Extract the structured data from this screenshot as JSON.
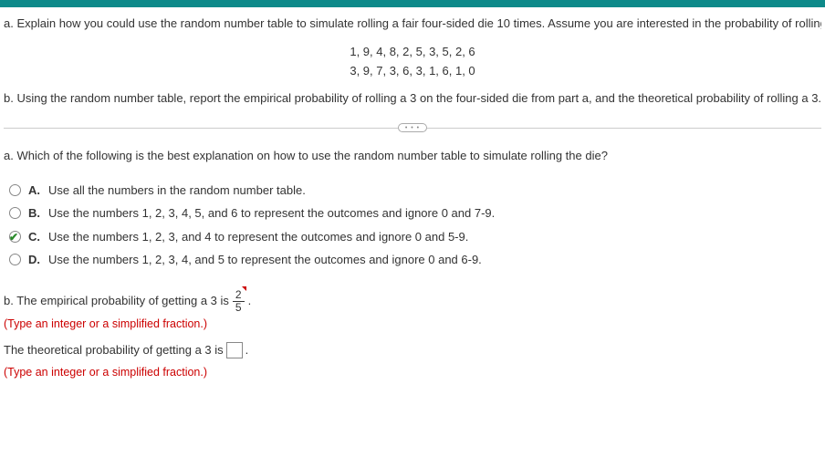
{
  "question_a": "a. Explain how you could use the random number table to simulate rolling a fair four-sided die 10 times. Assume you are interested in the probability of rolling",
  "numbers_line1": "1, 9, 4, 8, 2, 5, 3, 5, 2, 6",
  "numbers_line2": "3, 9, 7, 3, 6, 3, 1, 6, 1, 0",
  "question_b": "b. Using the random number table, report the empirical probability of rolling a 3 on the four-sided die from part a, and the theoretical probability of rolling a 3.",
  "expand_label": "• • •",
  "sub_a": "a. Which of the following is the best explanation on how to use the random number table to simulate rolling the die?",
  "choices": [
    {
      "letter": "A.",
      "text": "Use all the numbers in the random number table.",
      "checked": false
    },
    {
      "letter": "B.",
      "text": "Use the numbers 1, 2, 3, 4, 5, and 6 to represent the outcomes and ignore 0 and 7-9.",
      "checked": false
    },
    {
      "letter": "C.",
      "text": "Use the numbers 1, 2, 3, and 4 to represent the outcomes and ignore 0 and 5-9.",
      "checked": true
    },
    {
      "letter": "D.",
      "text": "Use the numbers 1, 2, 3, 4, and 5 to represent the outcomes and ignore 0 and 6-9.",
      "checked": false
    }
  ],
  "answer_b": {
    "prefix": "b. The empirical probability of getting a 3 is",
    "fraction_num": "2",
    "fraction_den": "5",
    "suffix": "."
  },
  "hint1": "(Type an integer or a simplified fraction.)",
  "theoretical": {
    "prefix": "The theoretical probability of getting a 3 is",
    "suffix": "."
  },
  "hint2": "(Type an integer or a simplified fraction.)"
}
